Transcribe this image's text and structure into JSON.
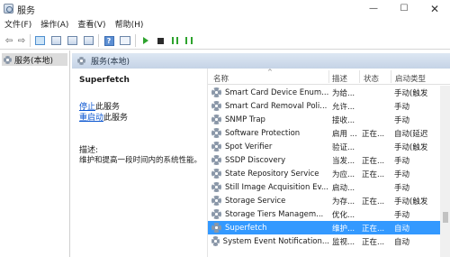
{
  "window": {
    "title": "服务"
  },
  "window_controls": {
    "minimize": "—",
    "maximize": "☐",
    "close": "✕"
  },
  "menu": {
    "items": [
      "文件(F)",
      "操作(A)",
      "查看(V)",
      "帮助(H)"
    ]
  },
  "toolbar": {
    "back": "⇦",
    "forward": "⇨"
  },
  "tree": {
    "node_label": "服务(本地)"
  },
  "content": {
    "header_title": "服务(本地)"
  },
  "detail": {
    "service_name": "Superfetch",
    "stop_link": "停止",
    "stop_suffix": "此服务",
    "restart_link": "重启动",
    "restart_suffix": "此服务",
    "description_label": "描述:",
    "description_text": "维护和提高一段时间内的系统性能。"
  },
  "list": {
    "columns": {
      "name": "名称",
      "description": "描述",
      "status": "状态",
      "startup": "启动类型"
    },
    "sort_indicator": "^",
    "rows": [
      {
        "name": "Smart Card Device Enum...",
        "description": "为给...",
        "status": "",
        "startup": "手动(触发"
      },
      {
        "name": "Smart Card Removal Poli...",
        "description": "允许...",
        "status": "",
        "startup": "手动"
      },
      {
        "name": "SNMP Trap",
        "description": "接收...",
        "status": "",
        "startup": "手动"
      },
      {
        "name": "Software Protection",
        "description": "启用 ...",
        "status": "正在...",
        "startup": "自动(延迟"
      },
      {
        "name": "Spot Verifier",
        "description": "验证...",
        "status": "",
        "startup": "手动(触发"
      },
      {
        "name": "SSDP Discovery",
        "description": "当发...",
        "status": "正在...",
        "startup": "手动"
      },
      {
        "name": "State Repository Service",
        "description": "为应...",
        "status": "正在...",
        "startup": "手动"
      },
      {
        "name": "Still Image Acquisition Ev...",
        "description": "启动...",
        "status": "",
        "startup": "手动"
      },
      {
        "name": "Storage Service",
        "description": "为存...",
        "status": "正在...",
        "startup": "手动(触发"
      },
      {
        "name": "Storage Tiers Managem...",
        "description": "优化...",
        "status": "",
        "startup": "手动"
      },
      {
        "name": "Superfetch",
        "description": "维护...",
        "status": "正在...",
        "startup": "自动",
        "selected": true
      },
      {
        "name": "System Event Notification...",
        "description": "监视...",
        "status": "正在...",
        "startup": "自动"
      }
    ]
  }
}
